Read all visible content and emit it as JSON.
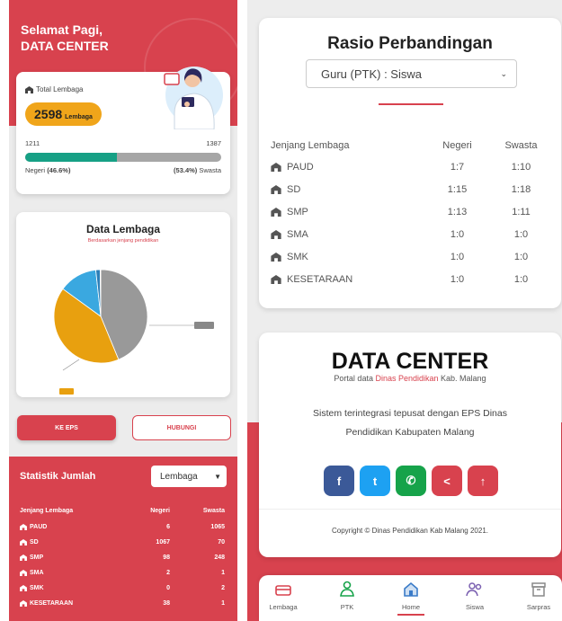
{
  "left_panel": {
    "greeting_line1": "Selamat Pagi,",
    "greeting_line2": "DATA CENTER",
    "total": {
      "label": "Total Lembaga",
      "value": "2598",
      "unit": "Lembaga",
      "negeri_count": "1211",
      "swasta_count": "1387",
      "negeri_pct_label": "Negeri",
      "negeri_pct": "(46.6%)",
      "swasta_pct": "(53.4%)",
      "swasta_pct_label": "Swasta",
      "negeri_fraction": 0.466
    },
    "data_lembaga": {
      "title": "Data Lembaga",
      "subtitle": "Berdasarkan jenjang pendidikan"
    },
    "buttons": {
      "eps_label": "KE EPS",
      "contact_label": "HUBUNGI"
    },
    "statistik": {
      "title": "Statistik Jumlah",
      "select_value": "Lembaga",
      "headers": [
        "Jenjang Lembaga",
        "Negeri",
        "Swasta"
      ],
      "rows": [
        {
          "name": "PAUD",
          "negeri": "6",
          "swasta": "1065"
        },
        {
          "name": "SD",
          "negeri": "1067",
          "swasta": "70"
        },
        {
          "name": "SMP",
          "negeri": "98",
          "swasta": "248"
        },
        {
          "name": "SMA",
          "negeri": "2",
          "swasta": "1"
        },
        {
          "name": "SMK",
          "negeri": "0",
          "swasta": "2"
        },
        {
          "name": "KESETARAAN",
          "negeri": "38",
          "swasta": "1"
        }
      ]
    }
  },
  "chart_data": {
    "type": "pie",
    "title": "Data Lembaga",
    "subtitle": "Berdasarkan jenjang pendidikan",
    "slices": [
      {
        "value": 1137,
        "color": "#999999"
      },
      {
        "value": 1071,
        "color": "#e8a00f"
      },
      {
        "value": 346,
        "color": "#3aa8e0"
      },
      {
        "value": 39,
        "color": "#2c7fb8"
      },
      {
        "value": 3,
        "color": "#16a085"
      },
      {
        "value": 2,
        "color": "#444444"
      }
    ]
  },
  "rasio": {
    "title": "Rasio Perbandingan",
    "select_value": "Guru (PTK) : Siswa",
    "headers": [
      "Jenjang Lembaga",
      "Negeri",
      "Swasta"
    ],
    "rows": [
      {
        "name": "PAUD",
        "negeri": "1:7",
        "swasta": "1:10"
      },
      {
        "name": "SD",
        "negeri": "1:15",
        "swasta": "1:18"
      },
      {
        "name": "SMP",
        "negeri": "1:13",
        "swasta": "1:11"
      },
      {
        "name": "SMA",
        "negeri": "1:0",
        "swasta": "1:0"
      },
      {
        "name": "SMK",
        "negeri": "1:0",
        "swasta": "1:0"
      },
      {
        "name": "KESETARAAN",
        "negeri": "1:0",
        "swasta": "1:0"
      }
    ]
  },
  "datacenter": {
    "title": "DATA CENTER",
    "sub_prefix": "Portal data",
    "sub_highlight": "Dinas Pendidikan",
    "sub_suffix": "Kab. Malang",
    "desc": "Sistem terintegrasi tepusat dengan EPS Dinas Pendidikan Kabupaten Malang",
    "social": [
      {
        "icon": "facebook-icon",
        "glyph": "f",
        "color": "#3b5998"
      },
      {
        "icon": "twitter-icon",
        "glyph": "t",
        "color": "#1da1f2"
      },
      {
        "icon": "phone-icon",
        "glyph": "✆",
        "color": "#16a34a"
      },
      {
        "icon": "share-icon",
        "glyph": "<",
        "color": "#d8424e"
      },
      {
        "icon": "arrow-up-icon",
        "glyph": "↑",
        "color": "#d8424e"
      }
    ],
    "copyright": "Copyright © Dinas Pendidikan Kab Malang 2021."
  },
  "bottom_nav": [
    {
      "label": "Lembaga",
      "icon": "building-icon"
    },
    {
      "label": "PTK",
      "icon": "teacher-icon"
    },
    {
      "label": "Home",
      "icon": "home-icon",
      "active": true
    },
    {
      "label": "Siswa",
      "icon": "students-icon"
    },
    {
      "label": "Sarpras",
      "icon": "inventory-icon"
    }
  ],
  "colors": {
    "brand_red": "#d8424e",
    "accent_orange": "#f0a51a",
    "negeri_green": "#16a085"
  }
}
